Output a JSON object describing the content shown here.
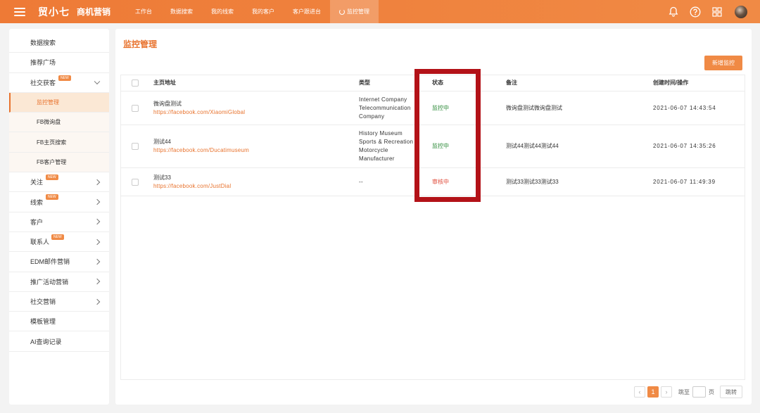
{
  "topbar": {
    "brand": "贸小七",
    "product": "商机营销",
    "nav": [
      "工作台",
      "数据搜索",
      "我的线索",
      "我的客户",
      "客户跟进台",
      "监控管理"
    ],
    "icons": [
      "bell-icon",
      "help-icon",
      "grid-icon",
      "avatar"
    ]
  },
  "sidebar": {
    "items": [
      {
        "label": "数据搜索"
      },
      {
        "label": "推荐广场"
      },
      {
        "label": "社交获客",
        "badge": "NEW"
      },
      {
        "label": "监控管理"
      },
      {
        "label": "FB微询盘"
      },
      {
        "label": "FB主页搜索"
      },
      {
        "label": "FB客户管理"
      },
      {
        "label": "关注",
        "badge": "NEW"
      },
      {
        "label": "线索",
        "badge": "NEW"
      },
      {
        "label": "客户"
      },
      {
        "label": "联系人",
        "badge": "NEW"
      },
      {
        "label": "EDM邮件营销"
      },
      {
        "label": "推广活动营销"
      },
      {
        "label": "社交营销"
      },
      {
        "label": "模板管理"
      },
      {
        "label": "AI查询记录"
      }
    ]
  },
  "main": {
    "title": "监控管理",
    "add_button": "新增监控",
    "columns": {
      "url": "主页地址",
      "type": "类型",
      "status": "状态",
      "note": "备注",
      "created": "创建时间/操作"
    },
    "rows": [
      {
        "name": "微询盘测试",
        "url": "https://facebook.com/XiaomiGlobal",
        "type": [
          "Internet Company",
          "Telecommunication",
          "Company"
        ],
        "status": "监控中",
        "note": "微询盘测试微询盘测试",
        "created": "2021-06-07 14:43:54"
      },
      {
        "name": "测试44",
        "url": "https://facebook.com/Ducatimuseum",
        "type": [
          "History Museum",
          "Sports & Recreation",
          "Motorcycle",
          "Manufacturer"
        ],
        "status": "监控中",
        "note": "测试44测试44测试44",
        "created": "2021-06-07 14:35:26"
      },
      {
        "name": "测试33",
        "url": "https://facebook.com/JustDial",
        "type": [
          "--"
        ],
        "status": "审核中",
        "note": "测试33测试33测试33",
        "created": "2021-06-07 11:49:39"
      }
    ]
  },
  "pagination": {
    "prev": "‹",
    "current": "1",
    "next": "›",
    "goto_label": "跳至",
    "page_unit": "页",
    "go_button": "跳转"
  },
  "colors": {
    "accent": "#f08a45",
    "highlight": "#b31218",
    "green": "#2e8b3a",
    "red": "#e04b3a"
  }
}
